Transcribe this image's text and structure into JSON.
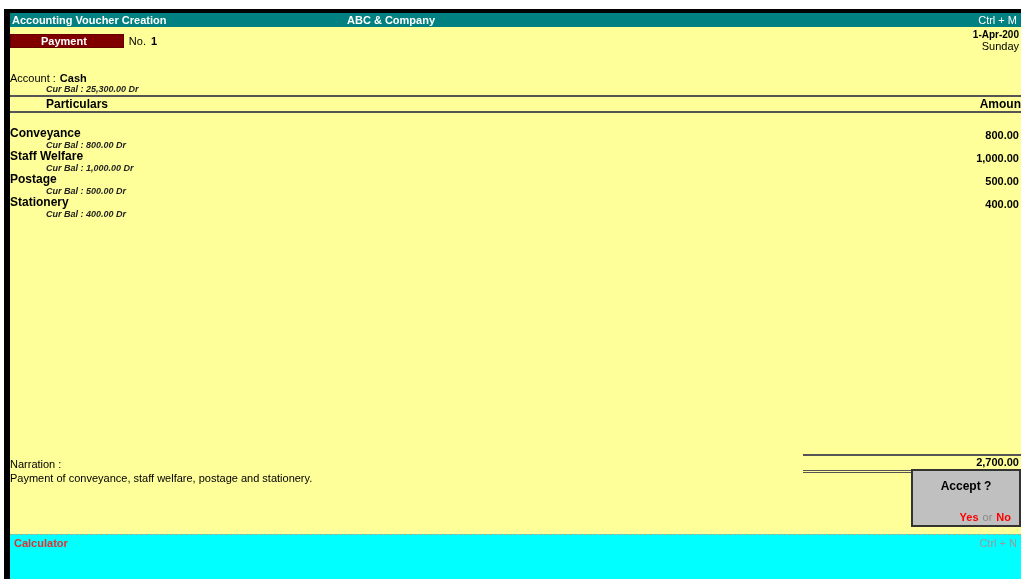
{
  "title_bar": {
    "left": "Accounting Voucher Creation",
    "center": "ABC & Company",
    "right": "Ctrl + M"
  },
  "voucher": {
    "type": "Payment",
    "number_label": "No.",
    "number": "1",
    "date": "1-Apr-200",
    "day": "Sunday"
  },
  "account": {
    "label": "Account :",
    "name": "Cash",
    "balance": "Cur Bal : 25,300.00 Dr"
  },
  "table": {
    "columns": [
      "Particulars",
      "Amoun"
    ],
    "rows": [
      {
        "ledger": "Conveyance",
        "balance": "Cur Bal : 800.00 Dr",
        "amount": "800.00"
      },
      {
        "ledger": "Staff Welfare",
        "balance": "Cur Bal : 1,000.00 Dr",
        "amount": "1,000.00"
      },
      {
        "ledger": "Postage",
        "balance": "Cur Bal : 500.00 Dr",
        "amount": "500.00"
      },
      {
        "ledger": "Stationery",
        "balance": "Cur Bal : 400.00 Dr",
        "amount": "400.00"
      }
    ],
    "total": "2,700.00"
  },
  "narration": {
    "label": "Narration :",
    "text": "Payment of conveyance, staff welfare, postage and stationery."
  },
  "dialog": {
    "title": "Accept ?",
    "yes": "Yes",
    "or": "or",
    "no": "No"
  },
  "bottom_bar": {
    "left": "Calculator",
    "right": "Ctrl + N"
  }
}
